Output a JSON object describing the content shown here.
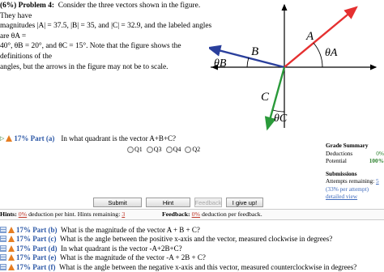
{
  "problem": {
    "heading": "(6%) Problem 4:",
    "text_lines": [
      "Consider the three vectors shown in the figure. They have",
      "magnitudes |A| = 37.5, |B| = 35, and |C| = 32.9, and the labeled angles are θA =",
      "40°, θB = 20°, and θC = 15°. Note that the figure shows the definitions of the",
      "angles, but the arrows in the figure may not be to scale."
    ]
  },
  "figure": {
    "labels": {
      "A": "A",
      "thetaA": "θA",
      "B": "B",
      "thetaB": "θB",
      "C": "C",
      "thetaC": "θC"
    },
    "colors": {
      "A": "#e53030",
      "B": "#2a3f9c",
      "C": "#2a9a3a",
      "axes": "#000000"
    }
  },
  "part_a": {
    "title": "17% Part (a)",
    "question": "In what quadrant is the vector A+B+C?",
    "options": [
      "Q1",
      "Q3",
      "Q4",
      "Q2"
    ]
  },
  "grade_summary": {
    "title": "Grade Summary",
    "deductions_label": "Deductions",
    "deductions_value": "0%",
    "potential_label": "Potential",
    "potential_value": "100%",
    "submissions_title": "Submissions",
    "attempts_label": "Attempts remaining:",
    "attempts_value": "5",
    "per_attempt": "(33% per attempt)",
    "detailed_view": "detailed view"
  },
  "buttons": {
    "submit": "Submit",
    "hint": "Hint",
    "feedback": "Feedback",
    "give_up": "I give up!"
  },
  "hints_bar": {
    "hints_label": "Hints:",
    "hints_pct": "0%",
    "hints_text": "deduction per hint. Hints remaining:",
    "hints_remaining": "3",
    "feedback_label": "Feedback:",
    "feedback_pct": "0%",
    "feedback_text": "deduction per feedback."
  },
  "other_parts": [
    {
      "title": "17% Part (b)",
      "question": "What is the magnitude of the vector A + B + C?"
    },
    {
      "title": "17% Part (c)",
      "question": "What is the angle between the positive x-axis and the vector, measured clockwise in degrees?"
    },
    {
      "title": "17% Part (d)",
      "question": "In what quadrant is the vector -A+2B+C?"
    },
    {
      "title": "17% Part (e)",
      "question": "What is the magnitude of the vector -A + 2B + C?"
    },
    {
      "title": "17% Part (f)",
      "question": "What is the angle between the negative x-axis and this vector, measured counterclockwise in degrees?"
    }
  ]
}
